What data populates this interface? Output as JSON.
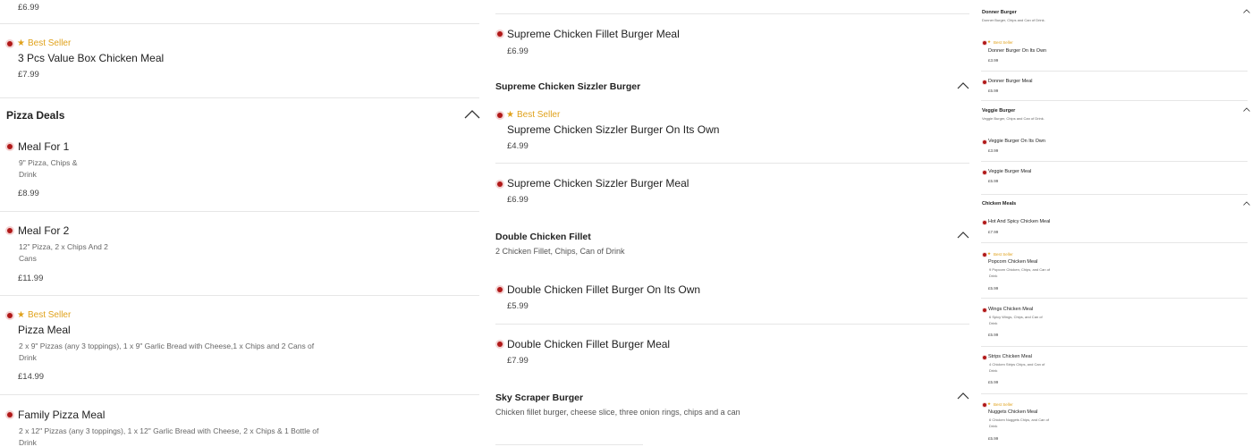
{
  "labels": {
    "best_seller": "Best Seller"
  },
  "col1": {
    "top_price": "£6.99",
    "value_box": {
      "title": "3 Pcs Value Box Chicken Meal",
      "price": "£7.99"
    },
    "pizza_deals": {
      "title": "Pizza Deals",
      "items": [
        {
          "title": "Meal For 1",
          "desc_l1": "9\" Pizza, Chips &",
          "desc_l2": "Drink",
          "price": "£8.99"
        },
        {
          "title": "Meal For 2",
          "desc_l1": "12\" Pizza, 2 x Chips And 2",
          "desc_l2": "Cans",
          "price": "£11.99"
        },
        {
          "title": "Pizza Meal",
          "desc_l1": "2 x 9\" Pizzas (any 3 toppings), 1 x 9\" Garlic Bread with Cheese,1 x Chips and 2 Cans of",
          "desc_l2": "Drink",
          "price": "£14.99"
        },
        {
          "title": "Family Pizza Meal",
          "desc_l1": "2 x 12\" Pizzas (any 3 toppings), 1 x 12\" Garlic Bread with Cheese, 2 x Chips & 1 Bottle of",
          "desc_l2": "Drink"
        }
      ]
    }
  },
  "col2": {
    "fillet_meal": {
      "title": "Supreme Chicken Fillet Burger Meal",
      "price": "£6.99"
    },
    "sizzler": {
      "title": "Supreme Chicken Sizzler Burger",
      "items": [
        {
          "title": "Supreme Chicken Sizzler Burger On Its Own",
          "price": "£4.99"
        },
        {
          "title": "Supreme Chicken Sizzler Burger Meal",
          "price": "£6.99"
        }
      ]
    },
    "double": {
      "title": "Double Chicken Fillet",
      "desc": "2 Chicken Fillet, Chips, Can of Drink",
      "items": [
        {
          "title": "Double Chicken Fillet Burger On Its Own",
          "price": "£5.99"
        },
        {
          "title": "Double Chicken Fillet Burger Meal",
          "price": "£7.99"
        }
      ]
    },
    "skyscraper": {
      "title": "Sky Scraper Burger",
      "desc": "Chicken fillet burger, cheese slice, three onion rings, chips and a can"
    }
  },
  "col3": {
    "donner": {
      "title": "Donner Burger",
      "desc": "Donner Burger, Chips and Can of Drink.",
      "items": [
        {
          "title": "Donner Burger On Its Own",
          "price": "£3.99"
        },
        {
          "title": "Donner Burger Meal",
          "price": "£5.99"
        }
      ]
    },
    "veggie": {
      "title": "Veggie Burger",
      "desc": "Veggie Burger, Chips and Can of Drink.",
      "items": [
        {
          "title": "Veggie Burger On Its Own",
          "price": "£3.99"
        },
        {
          "title": "Veggie Burger Meal",
          "price": "£5.99"
        }
      ]
    },
    "chicken_meals": {
      "title": "Chicken Meals",
      "items": [
        {
          "title": "Hot And Spicy Chicken Meal",
          "price": "£7.99"
        },
        {
          "title": "Popcorn Chicken Meal",
          "desc_l1": "9 Popcorn Chicken, Chips, and Can of",
          "desc_l2": "Drink",
          "price": "£5.99"
        },
        {
          "title": "Wings Chicken Meal",
          "desc_l1": "6 Spicy Wings, Chips, and Can of",
          "desc_l2": "Drink",
          "price": "£5.99"
        },
        {
          "title": "Strips Chicken Meal",
          "desc_l1": "4 Chicken Strips Chips, and Can of",
          "desc_l2": "Drink",
          "price": "£5.99"
        },
        {
          "title": "Nuggets Chicken Meal",
          "desc_l1": "6 Chicken Nuggets Chips, and Can of",
          "desc_l2": "Drink",
          "price": "£5.99"
        }
      ]
    }
  },
  "colors": {
    "accent_dot": "#b01818",
    "best_seller": "#e0a21c",
    "divider": "#e6e6e6"
  },
  "icons": {
    "collapse": "chevron-up-icon",
    "best_seller": "star-icon",
    "item_marker": "red-dot-icon"
  }
}
